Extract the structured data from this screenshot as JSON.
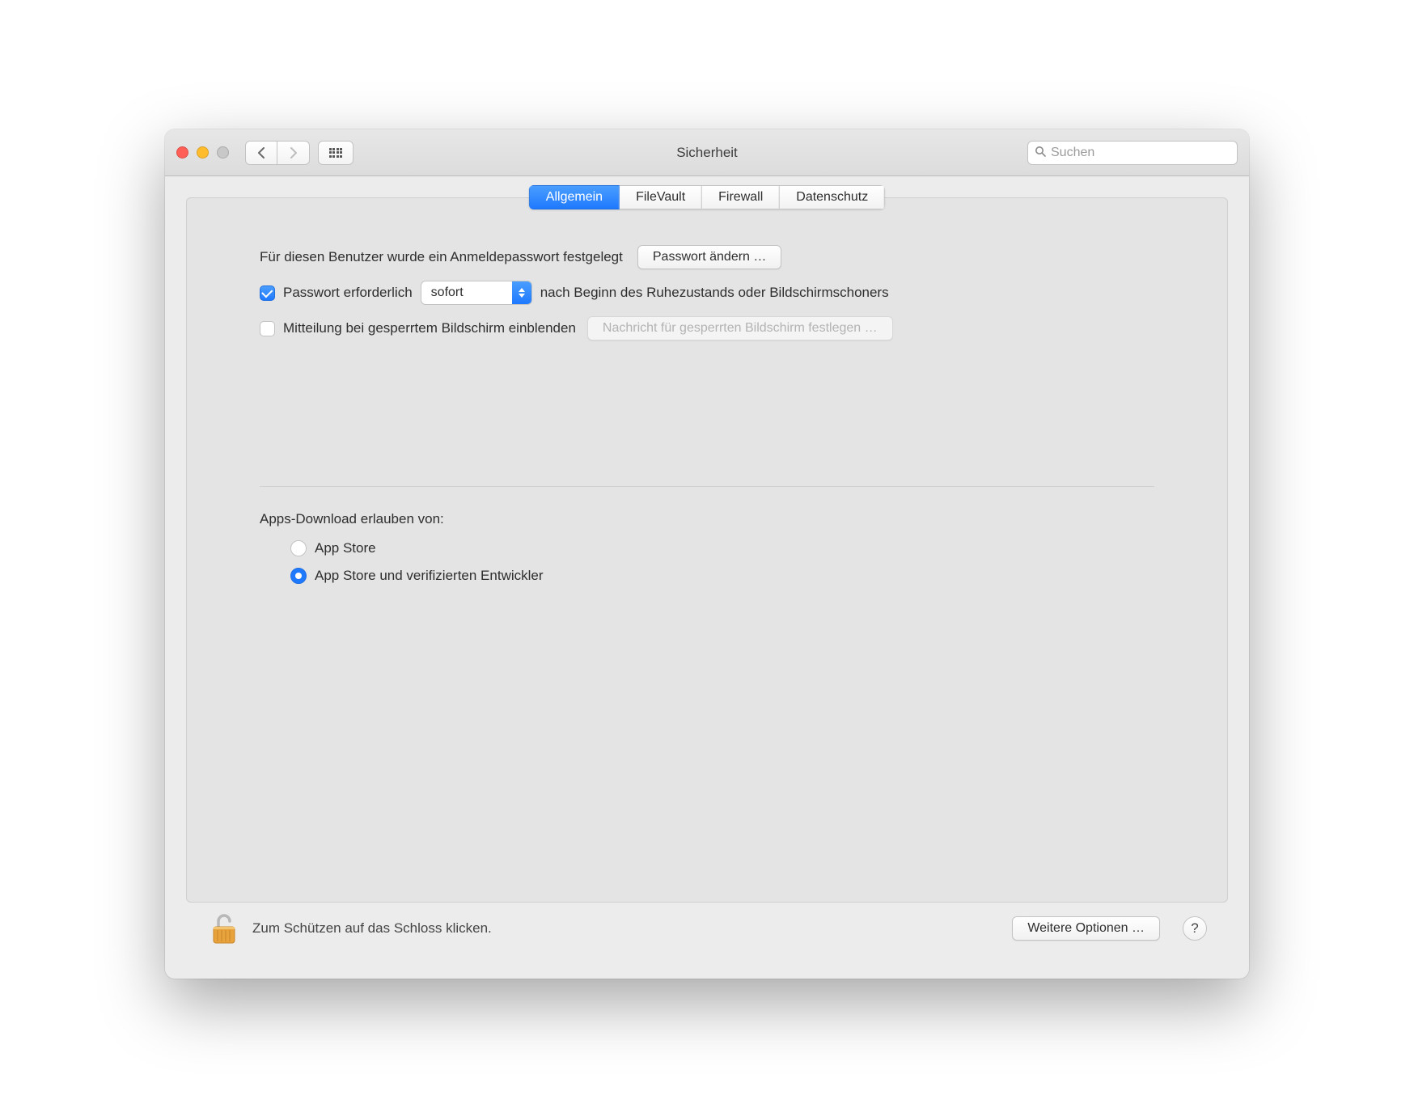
{
  "window": {
    "title": "Sicherheit",
    "search_placeholder": "Suchen"
  },
  "tabs": {
    "general": "Allgemein",
    "filevault": "FileVault",
    "firewall": "Firewall",
    "privacy": "Datenschutz"
  },
  "login_section": {
    "password_set_label": "Für diesen Benutzer wurde ein Anmeldepasswort festgelegt",
    "change_password_button": "Passwort ändern …",
    "require_password_label": "Passwort erforderlich",
    "require_password_checked": true,
    "delay_select_value": "sofort",
    "after_sleep_label": "nach Beginn des Ruhezustands oder Bildschirmschoners",
    "show_lock_message_label": "Mitteilung bei gesperrtem Bildschirm einblenden",
    "show_lock_message_checked": false,
    "set_lock_message_button": "Nachricht für gesperrten Bildschirm festlegen …"
  },
  "download_section": {
    "heading": "Apps-Download erlauben von:",
    "option_app_store": "App Store",
    "option_identified": "App Store und verifizierten Entwickler",
    "selected": "identified"
  },
  "footer": {
    "lock_text": "Zum Schützen auf das Schloss klicken.",
    "more_options_button": "Weitere Optionen …",
    "help_label": "?"
  }
}
